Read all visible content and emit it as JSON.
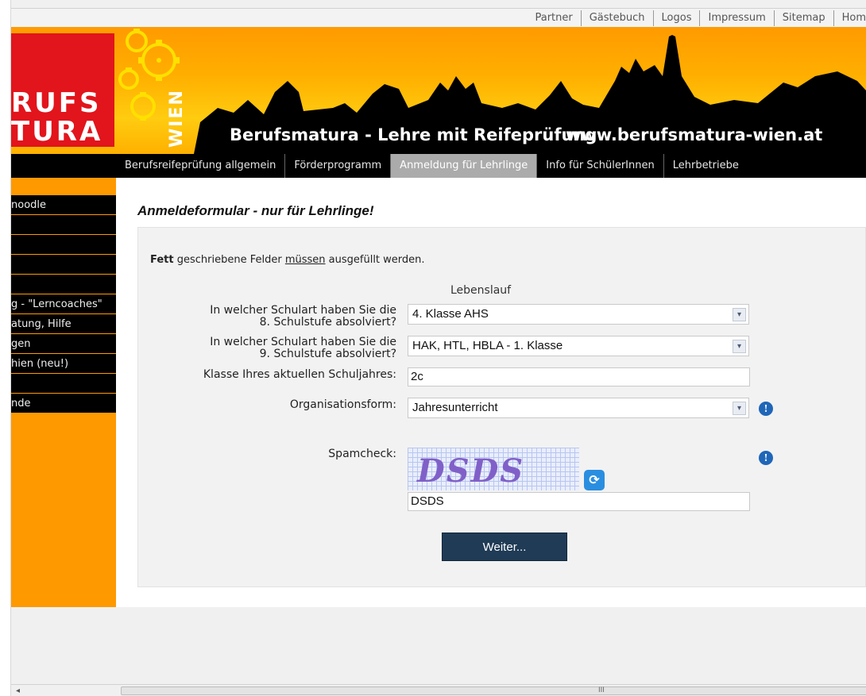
{
  "top_links": [
    "Partner",
    "Gästebuch",
    "Logos",
    "Impressum",
    "Sitemap",
    "Hom"
  ],
  "banner": {
    "logo_line1": "RUFS",
    "logo_line2": "TURA",
    "wien": "WIEN",
    "slogan": "Berufsmatura - Lehre mit Reifeprüfung",
    "url": "www.berufsmatura-wien.at"
  },
  "main_nav": [
    {
      "label": "Berufsreifeprüfung allgemein",
      "active": false
    },
    {
      "label": "Förderprogramm",
      "active": false
    },
    {
      "label": "Anmeldung für Lehrlinge",
      "active": true
    },
    {
      "label": "Info für SchülerInnen",
      "active": false
    },
    {
      "label": "Lehrbetriebe",
      "active": false
    }
  ],
  "sidebar": [
    "noodle",
    "",
    "",
    "",
    "",
    "g - \"Lerncoaches\"",
    "atung, Hilfe",
    "gen",
    "hien (neu!)",
    "",
    "nde"
  ],
  "page_title": "Anmeldeformular - nur für Lehrlinge!",
  "form": {
    "note_bold": "Fett",
    "note_part1": " geschriebene Felder ",
    "note_underline": "müssen",
    "note_part2": " ausgefüllt werden.",
    "section_title": "Lebenslauf",
    "q1_line1": "In welcher Schulart haben Sie die",
    "q1_line2": "8. Schulstufe absolviert?",
    "q1_value": "4. Klasse AHS",
    "q2_line1": "In welcher Schulart haben Sie die",
    "q2_line2": "9. Schulstufe absolviert?",
    "q2_value": "HAK, HTL, HBLA - 1. Klasse",
    "class_label": "Klasse Ihres aktuellen Schuljahres:",
    "class_value": "2c",
    "org_label": "Organisationsform:",
    "org_value": "Jahresunterricht",
    "spam_label": "Spamcheck:",
    "captcha_text": "DSDS",
    "spam_value": "DSDS",
    "submit": "Weiter..."
  },
  "scrollbar": {
    "grip": "III"
  },
  "colors": {
    "orange": "#ff9900",
    "red": "#e2141c",
    "nav_active": "#ababab",
    "submit_bg": "#1f3b55",
    "info_blue": "#1f66b8"
  }
}
